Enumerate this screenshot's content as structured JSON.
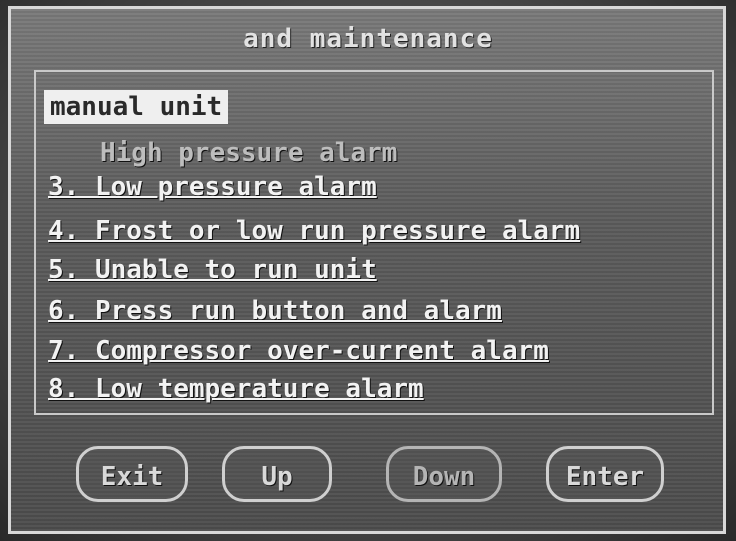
{
  "screen": {
    "title": "and maintenance"
  },
  "menu": {
    "items": [
      {
        "label": "manual unit"
      },
      {
        "label": "High pressure alarm"
      },
      {
        "label": "3. Low pressure alarm"
      },
      {
        "label": "4. Frost or low run pressure alarm"
      },
      {
        "label": "5. Unable to run unit"
      },
      {
        "label": "6. Press run button and alarm"
      },
      {
        "label": "7. Compressor over-current alarm"
      },
      {
        "label": "8. Low temperature alarm"
      }
    ]
  },
  "buttons": {
    "exit": "Exit",
    "up": "Up",
    "down": "Down",
    "enter": "Enter"
  }
}
